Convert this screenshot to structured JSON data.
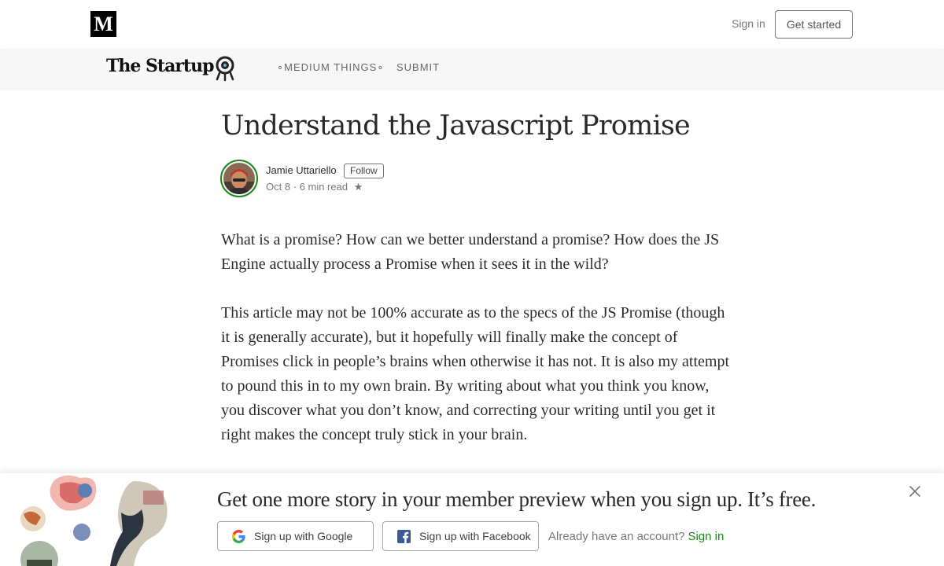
{
  "header": {
    "logo_letter": "M",
    "sign_in_label": "Sign in",
    "get_started_label": "Get started"
  },
  "publication": {
    "name": "The Startup",
    "nav": [
      "∘MEDIUM THINGS∘",
      "SUBMIT"
    ]
  },
  "article": {
    "title": "Understand the Javascript Promise",
    "author": "Jamie Uttariello",
    "follow_label": "Follow",
    "date": "Oct 8",
    "read_time": "6 min read",
    "star": "★",
    "paragraphs": [
      "What is a promise? How can we better understand a promise? How does the JS Engine actually process a Promise when it sees it in the wild?",
      "This article may not be 100% accurate as to the specs of the JS Promise (though it is generally accurate), but it hopefully will finally make the concept of Promises click in people’s brains when otherwise it has not. It is also my attempt to pound this in to my own brain. By writing about what you think you know, you discover what you don’t know, and correcting your writing until you get it right makes the concept truly stick in your brain."
    ]
  },
  "banner": {
    "title": "Get one more story in your member preview when you sign up. It’s free.",
    "google_label": "Sign up with Google",
    "facebook_label": "Sign up with Facebook",
    "already_text": "Already have an account?",
    "signin_link": "Sign in"
  },
  "colors": {
    "accent_green": "#1a8917",
    "facebook_blue": "#3b5998",
    "pubbar_bg": "#f7f7f7"
  },
  "icons": [
    "medium-logo-icon",
    "startup-logo-icon",
    "google-icon",
    "facebook-icon",
    "close-icon",
    "star-icon"
  ]
}
